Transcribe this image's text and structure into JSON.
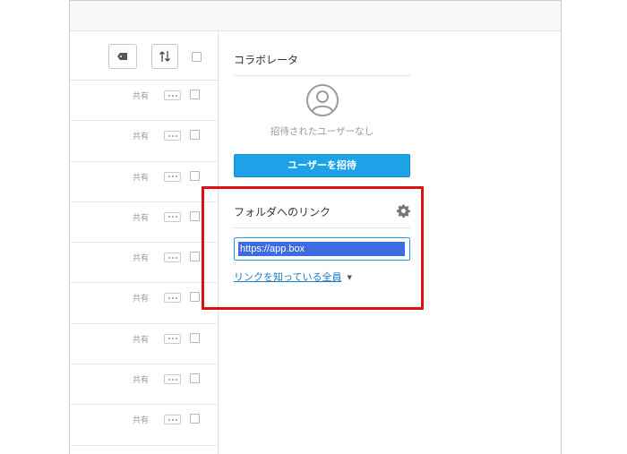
{
  "rows": [
    {
      "share": "共有"
    },
    {
      "share": "共有"
    },
    {
      "share": "共有"
    },
    {
      "share": "共有"
    },
    {
      "share": "共有"
    },
    {
      "share": "共有"
    },
    {
      "share": "共有"
    },
    {
      "share": "共有"
    },
    {
      "share": "共有"
    }
  ],
  "collaborators": {
    "title": "コラボレータ",
    "empty_text": "招待されたユーザーなし",
    "invite_label": "ユーザーを招待"
  },
  "folder_link": {
    "title": "フォルダへのリンク",
    "url": "https://app.box",
    "access_label": "リンクを知っている全員"
  },
  "colors": {
    "accent": "#1da2e7",
    "highlight_border": "#e01010",
    "selection": "#3d6ce0",
    "link": "#1a7bc7"
  },
  "icons": [
    "tag-icon",
    "sort-icon",
    "user-icon",
    "gear-icon",
    "caret-down-icon"
  ]
}
